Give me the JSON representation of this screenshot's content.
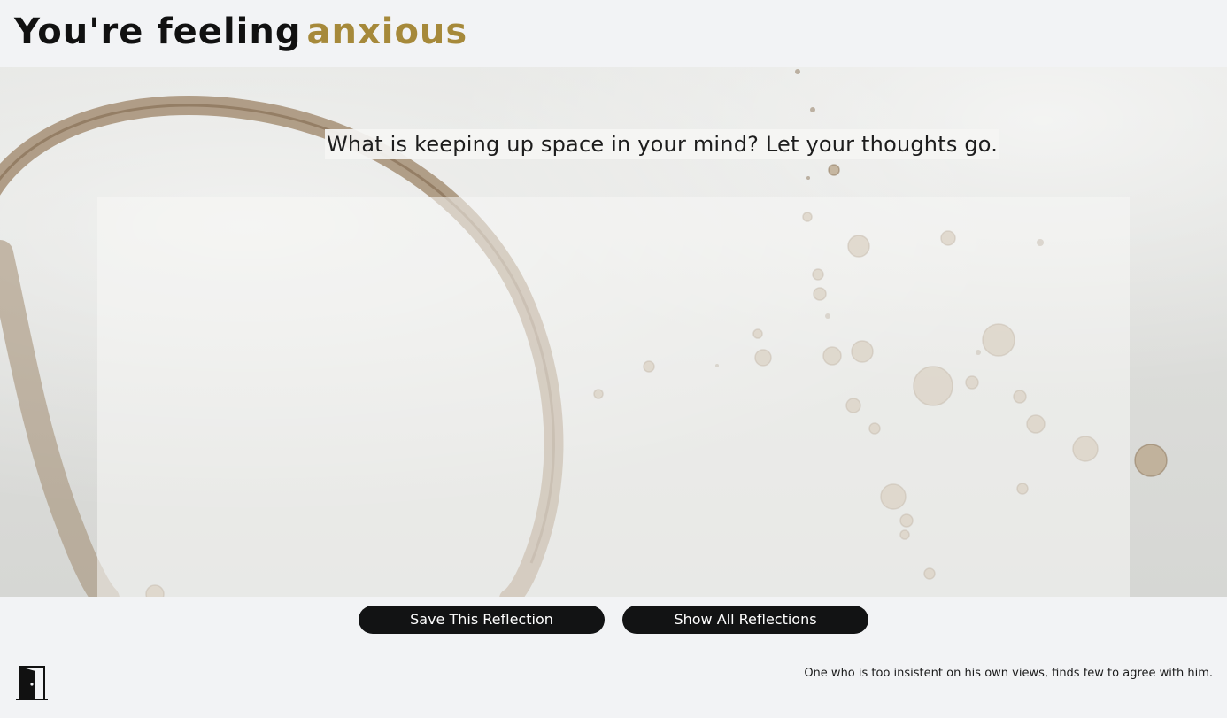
{
  "header": {
    "title_prefix": "You're feeling",
    "emotion": "anxious"
  },
  "main": {
    "prompt": "What is keeping up space in your mind? Let your thoughts go.",
    "reflection_value": "",
    "reflection_placeholder": ""
  },
  "actions": {
    "save_label": "Save This Reflection",
    "show_all_label": "Show All Reflections"
  },
  "footer": {
    "exit_icon": "door-exit-icon",
    "quote": "One who is too insistent on his own views, finds few to agree with him."
  },
  "colors": {
    "accent": "#a6893a",
    "button_bg": "#121314",
    "button_text": "#ffffff",
    "header_bg": "#f2f3f5"
  }
}
